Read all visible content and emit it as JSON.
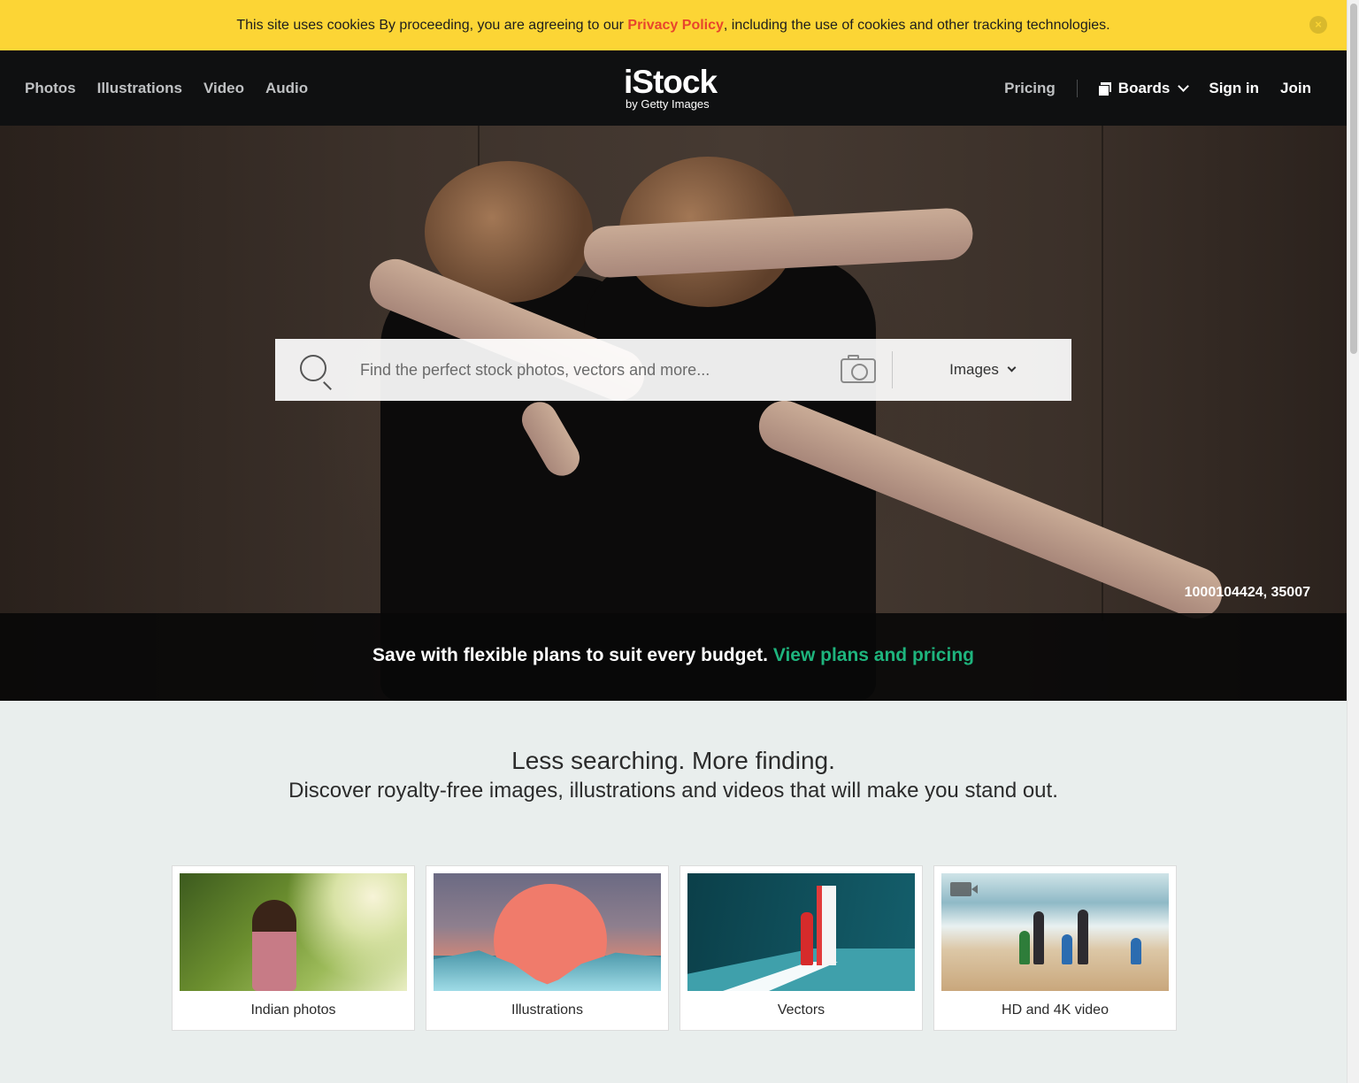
{
  "cookie_bar": {
    "text_before": "This site uses cookies By proceeding, you are agreeing to our ",
    "link": "Privacy Policy",
    "text_after": ", including the use of cookies and other tracking technologies.",
    "close": "×"
  },
  "header": {
    "nav_left": [
      "Photos",
      "Illustrations",
      "Video",
      "Audio"
    ],
    "logo_main": "iStock",
    "logo_sub": "by Getty Images",
    "pricing": "Pricing",
    "boards": "Boards",
    "signin": "Sign in",
    "join": "Join"
  },
  "search": {
    "placeholder": "Find the perfect stock photos, vectors and more...",
    "type": "Images"
  },
  "hero": {
    "credit": "1000104424, 35007",
    "promo_text": "Save with flexible plans to suit every budget. ",
    "promo_link": "View plans and pricing"
  },
  "intro": {
    "heading": "Less searching. More finding.",
    "subheading": "Discover royalty-free images, illustrations and videos that will make you stand out."
  },
  "cards": [
    {
      "label": "Indian photos"
    },
    {
      "label": "Illustrations"
    },
    {
      "label": "Vectors"
    },
    {
      "label": "HD and 4K video"
    }
  ],
  "colors": {
    "cookie_bg": "#fcd535",
    "privacy_link": "#e8452c",
    "header_bg": "#0f1011",
    "promo_link": "#1eb47d",
    "page_bg": "#e9eeed"
  },
  "icons": [
    "close-icon",
    "boards-icon",
    "chevron-down-icon",
    "search-icon",
    "camera-icon",
    "video-icon"
  ]
}
